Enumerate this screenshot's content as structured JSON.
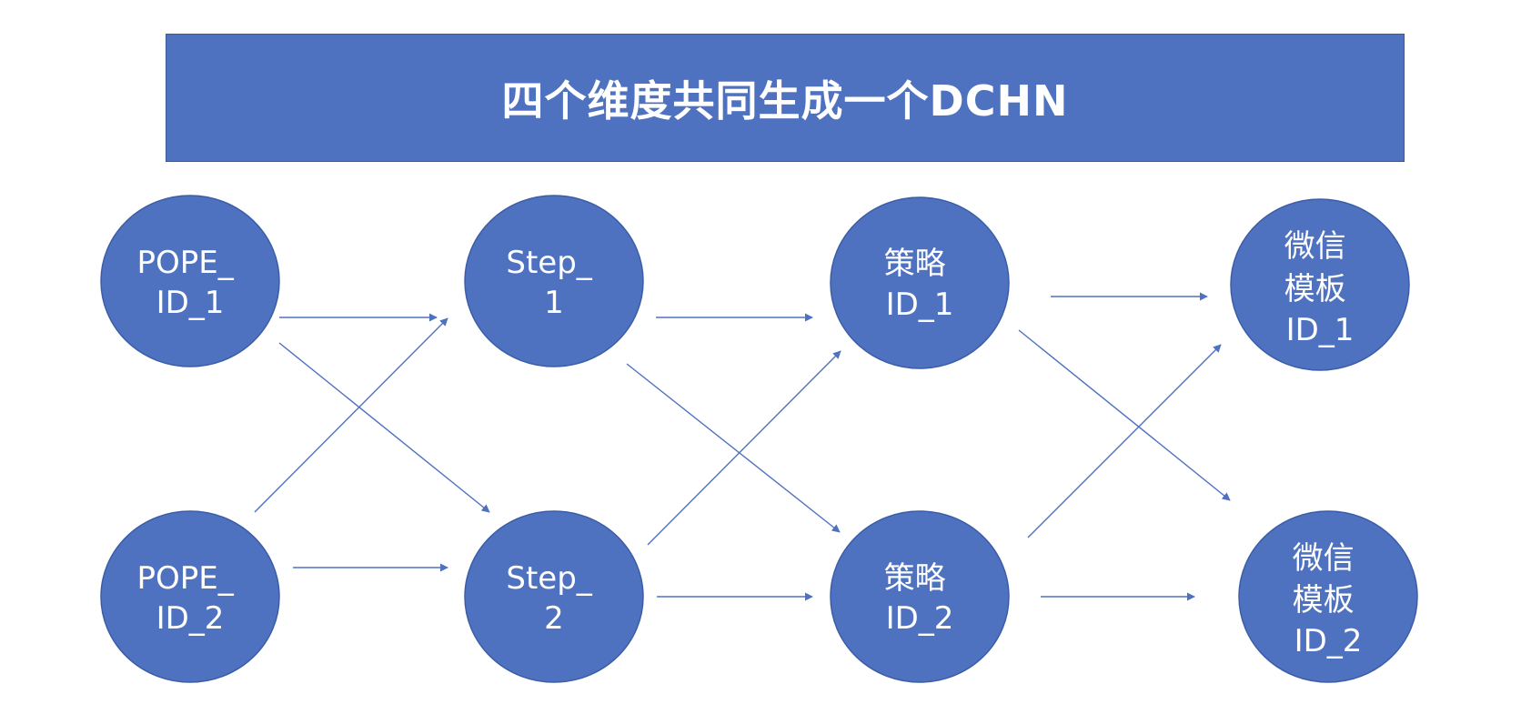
{
  "title": "四个维度共同生成一个DCHN",
  "colors": {
    "node_fill": "#4f72c0",
    "node_stroke": "#3b5da8",
    "edge": "#4f72c0",
    "title_bg": "#4f72c0",
    "text": "#ffffff"
  },
  "nodes": {
    "pope1": [
      "POPE_",
      "ID_1"
    ],
    "pope2": [
      "POPE_",
      "ID_2"
    ],
    "step1": [
      "Step_",
      "1"
    ],
    "step2": [
      "Step_",
      "2"
    ],
    "strategy1": [
      "策略",
      "ID_1"
    ],
    "strategy2": [
      "策略",
      "ID_2"
    ],
    "wechat1": [
      "微信",
      "模板",
      "ID_1"
    ],
    "wechat2": [
      "微信",
      "模板",
      "ID_2"
    ]
  }
}
